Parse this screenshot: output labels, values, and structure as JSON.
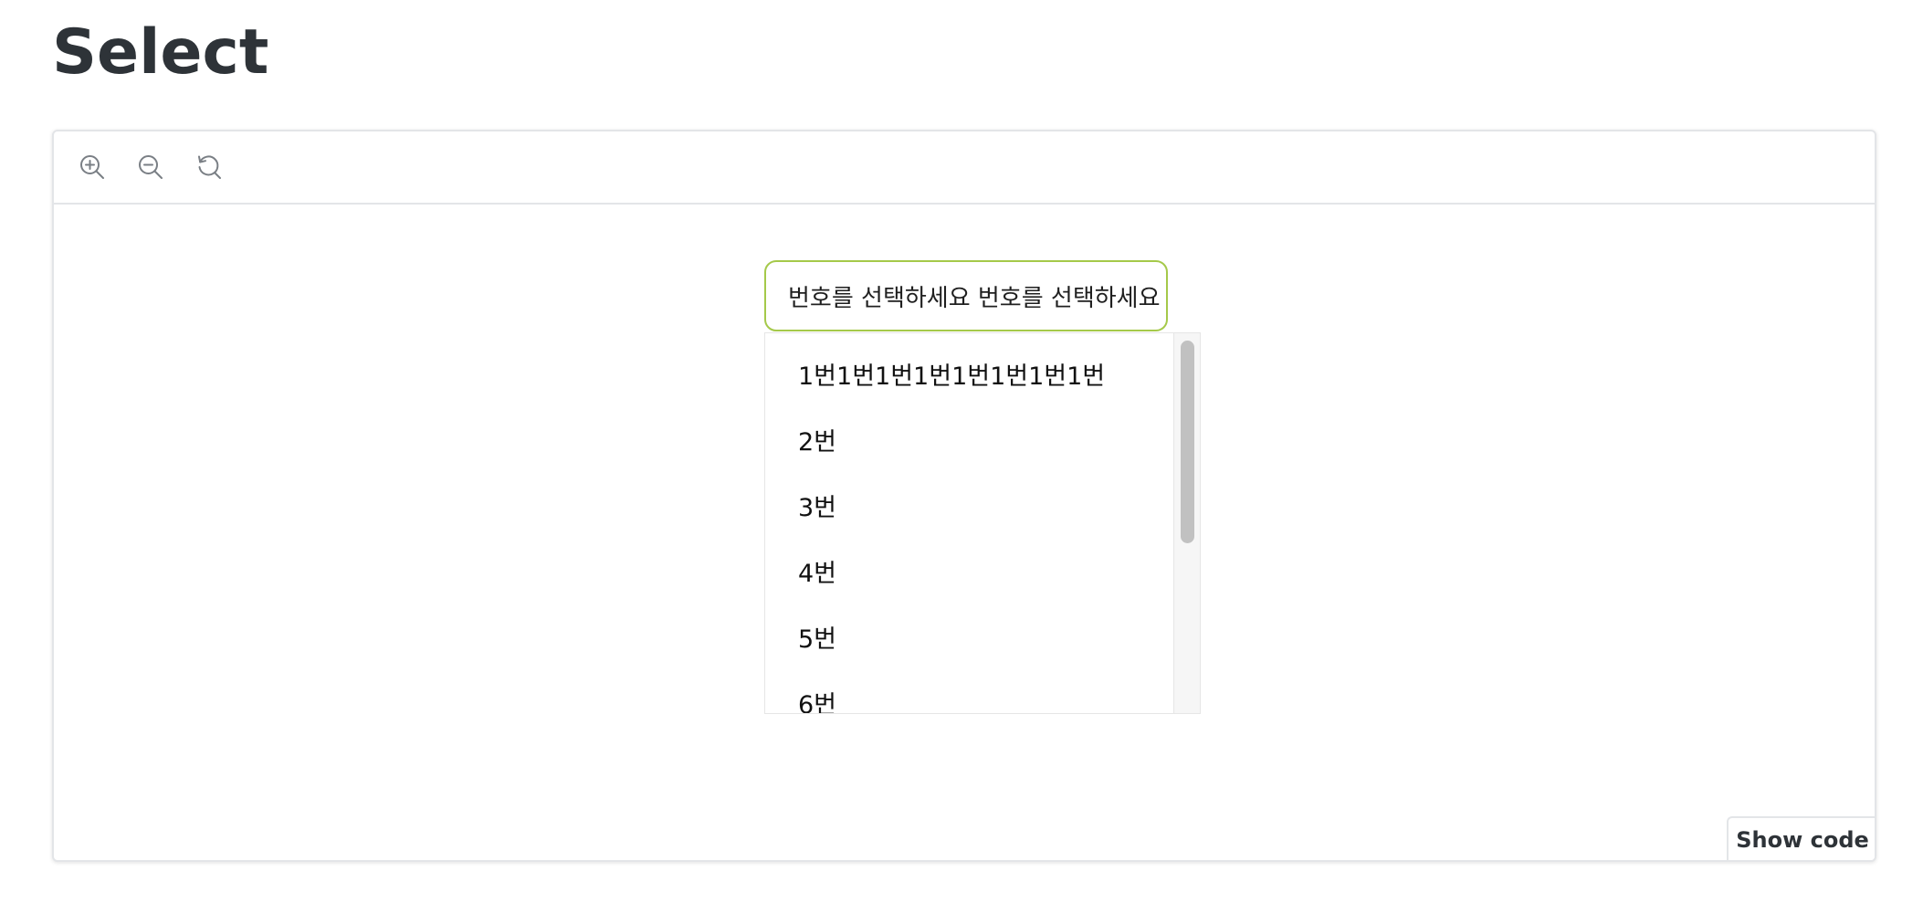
{
  "page": {
    "title": "Select"
  },
  "toolbar": {
    "zoom_in_icon": "zoom-in-icon",
    "zoom_out_icon": "zoom-out-icon",
    "reset_icon": "reset-icon"
  },
  "select": {
    "value": "번호를 선택하세요 번호를 선택하세요",
    "border_color": "#a5c94a"
  },
  "dropdown": {
    "options": [
      "1번1번1번1번1번1번1번1번",
      "2번",
      "3번",
      "4번",
      "5번",
      "6번"
    ]
  },
  "show_code": {
    "label": "Show code"
  }
}
